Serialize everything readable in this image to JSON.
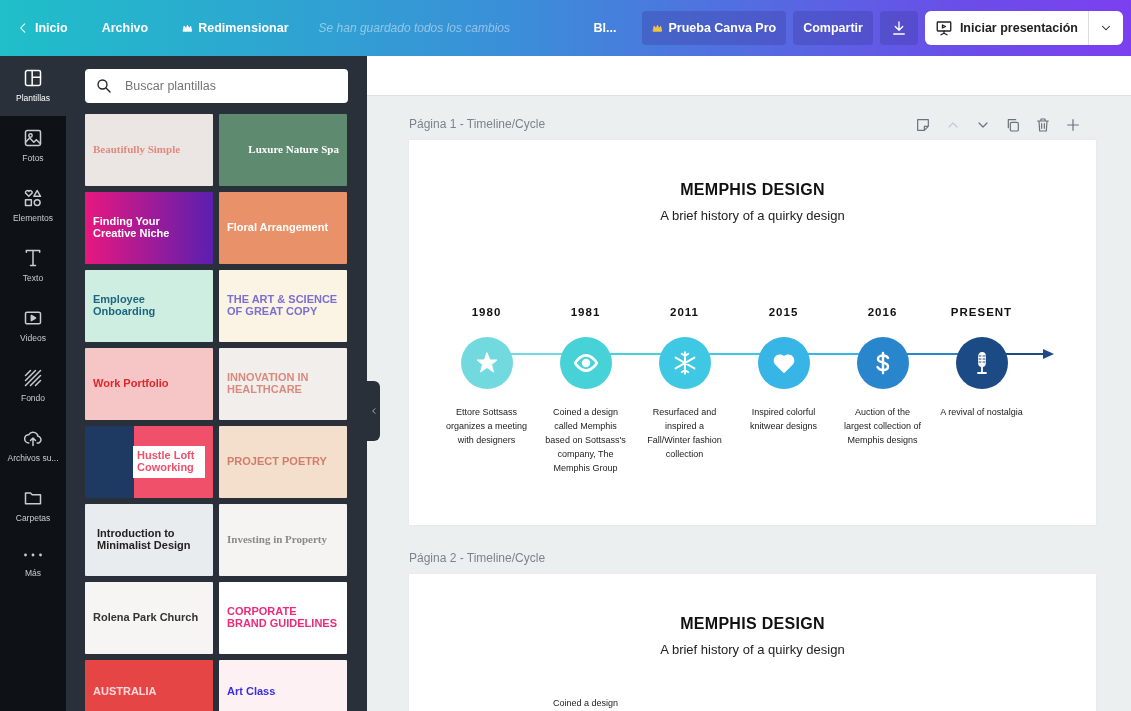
{
  "top_bar": {
    "back": "Inicio",
    "menu": [
      {
        "label": "Archivo"
      },
      {
        "label": "Redimensionar"
      }
    ],
    "save_status": "Se han guardado todos los cambios",
    "doc_title": "Bl...",
    "pro_button": "Prueba Canva Pro",
    "share_button": "Compartir",
    "present_button": "Iniciar presentación"
  },
  "sidebar": {
    "items": [
      {
        "label": "Plantillas",
        "selected": true
      },
      {
        "label": "Fotos",
        "selected": false
      },
      {
        "label": "Elementos",
        "selected": false
      },
      {
        "label": "Texto",
        "selected": false
      },
      {
        "label": "Videos",
        "selected": false
      },
      {
        "label": "Fondo",
        "selected": false
      },
      {
        "label": "Archivos su...",
        "selected": false
      },
      {
        "label": "Carpetas",
        "selected": false
      },
      {
        "label": "Más",
        "selected": false
      }
    ]
  },
  "templates_panel": {
    "search": {
      "placeholder": "Buscar plantillas"
    },
    "templates": [
      {
        "title": "Beautifully Simple"
      },
      {
        "title": "Luxure Nature Spa"
      },
      {
        "title": "Finding Your Creative Niche"
      },
      {
        "title": "Floral Arrangement"
      },
      {
        "title": "Employee Onboarding"
      },
      {
        "title": "THE ART & SCIENCE OF GREAT COPY"
      },
      {
        "title": "Work Portfolio"
      },
      {
        "title": "INNOVATION IN HEALTHCARE"
      },
      {
        "title": "Hustle Loft Coworking"
      },
      {
        "title": "PROJECT POETRY"
      },
      {
        "title": "Introduction to Minimalist Design"
      },
      {
        "title": "Investing in Property"
      },
      {
        "title": "Rolena Park Church"
      },
      {
        "title": "CORPORATE BRAND GUIDELINES"
      },
      {
        "title": "AUSTRALIA"
      },
      {
        "title": "Art Class"
      }
    ]
  },
  "pages": [
    {
      "label": "Página 1 - Timeline/Cycle",
      "actions": [
        {
          "disabled": false
        },
        {
          "disabled": true
        },
        {
          "disabled": false
        },
        {
          "disabled": false
        },
        {
          "disabled": false
        },
        {
          "disabled": false
        }
      ],
      "title": "MEMPHIS DESIGN",
      "subtitle": "A brief history of a quirky design",
      "timeline": [
        {
          "year": "1980",
          "color": "#72dade",
          "description": "Ettore Sottsass organizes a meeting with designers"
        },
        {
          "year": "1981",
          "color": "#47d2d8",
          "description": "Coined a design called Memphis based on Sottsass's company, The Memphis Group"
        },
        {
          "year": "2011",
          "color": "#3ec8e4",
          "description": "Resurfaced and inspired a Fall/Winter fashion collection"
        },
        {
          "year": "2015",
          "color": "#36b5e6",
          "description": "Inspired colorful knitwear designs"
        },
        {
          "year": "2016",
          "color": "#2a86cc",
          "description": "Auction of the largest collection of Memphis designs"
        },
        {
          "year": "PRESENT",
          "color": "#1b4a85",
          "description": "A revival of nostalgia"
        }
      ]
    },
    {
      "label": "Página 2 - Timeline/Cycle",
      "title": "MEMPHIS DESIGN",
      "subtitle": "A brief history of a quirky design",
      "timeline": [
        {
          "description": "Coined a design"
        }
      ]
    }
  ]
}
